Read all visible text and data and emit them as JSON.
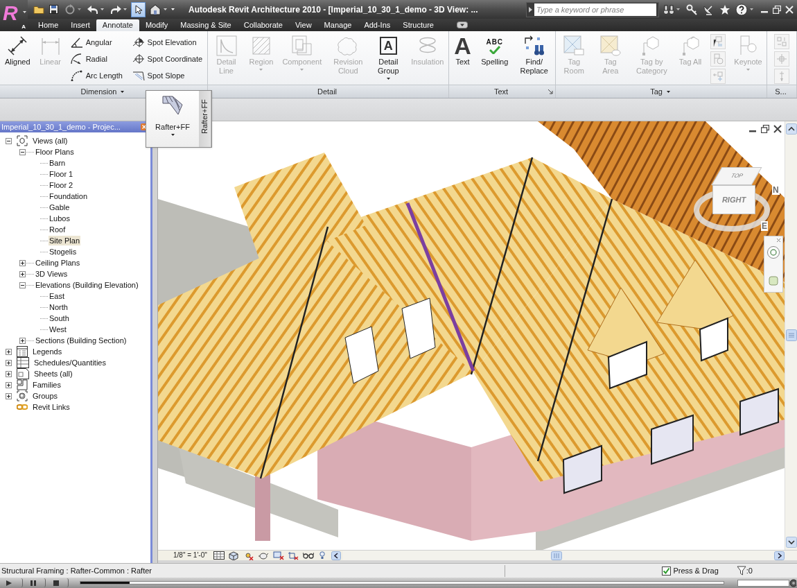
{
  "title_bar": {
    "logo_letter": "R",
    "logo_badge": "A",
    "title": "Autodesk Revit Architecture 2010 - [Imperial_10_30_1_demo - 3D View: ...",
    "search": {
      "placeholder": "Type a keyword or phrase"
    }
  },
  "ribbon_tabs": [
    {
      "label": "Home",
      "selected": false
    },
    {
      "label": "Insert",
      "selected": false
    },
    {
      "label": "Annotate",
      "selected": true
    },
    {
      "label": "Modify",
      "selected": false
    },
    {
      "label": "Massing & Site",
      "selected": false
    },
    {
      "label": "Collaborate",
      "selected": false
    },
    {
      "label": "View",
      "selected": false
    },
    {
      "label": "Manage",
      "selected": false
    },
    {
      "label": "Add-Ins",
      "selected": false
    },
    {
      "label": "Structure",
      "selected": false
    }
  ],
  "ribbon_panels": [
    {
      "title": "Dimension",
      "menu": true,
      "launcher": false,
      "columns": [
        {
          "kind": "large",
          "buttons": [
            {
              "label": "Aligned",
              "disabled": false,
              "menu": false
            }
          ]
        },
        {
          "kind": "large",
          "buttons": [
            {
              "label": "Linear",
              "disabled": true,
              "menu": false
            }
          ]
        },
        {
          "kind": "stack",
          "buttons": [
            {
              "label": "Angular",
              "disabled": false
            },
            {
              "label": "Radial",
              "disabled": false
            },
            {
              "label": "Arc Length",
              "disabled": false
            }
          ]
        },
        {
          "kind": "stack",
          "buttons": [
            {
              "label": "Spot Elevation",
              "disabled": false
            },
            {
              "label": "Spot Coordinate",
              "disabled": false
            },
            {
              "label": "Spot Slope",
              "disabled": false
            }
          ]
        }
      ]
    },
    {
      "title": "Detail",
      "menu": false,
      "launcher": false,
      "columns": [
        {
          "kind": "large",
          "buttons": [
            {
              "label": "Detail Line",
              "disabled": true,
              "menu": false
            }
          ]
        },
        {
          "kind": "large",
          "buttons": [
            {
              "label": "Region",
              "disabled": true,
              "menu": true
            }
          ]
        },
        {
          "kind": "large",
          "buttons": [
            {
              "label": "Component",
              "disabled": true,
              "menu": true
            }
          ]
        },
        {
          "kind": "large",
          "buttons": [
            {
              "label": "Revision Cloud",
              "disabled": true,
              "menu": false
            }
          ]
        },
        {
          "kind": "large",
          "buttons": [
            {
              "label": "Detail Group",
              "disabled": false,
              "menu": true,
              "glyph": "A"
            }
          ]
        },
        {
          "kind": "large",
          "buttons": [
            {
              "label": "Insulation",
              "disabled": true,
              "menu": false
            }
          ]
        }
      ]
    },
    {
      "title": "Text",
      "menu": false,
      "launcher": true,
      "columns": [
        {
          "kind": "large",
          "buttons": [
            {
              "label": "Text",
              "disabled": false,
              "menu": false,
              "glyph": "A"
            }
          ]
        },
        {
          "kind": "large",
          "buttons": [
            {
              "label": "Spelling",
              "disabled": false,
              "menu": false,
              "glyph": "ABC"
            }
          ]
        },
        {
          "kind": "large",
          "buttons": [
            {
              "label": "Find/Replace",
              "disabled": false,
              "menu": false
            }
          ]
        }
      ]
    },
    {
      "title": "Tag",
      "menu": true,
      "launcher": false,
      "columns": [
        {
          "kind": "large",
          "buttons": [
            {
              "label": "Tag Room",
              "disabled": true,
              "menu": false
            }
          ]
        },
        {
          "kind": "large",
          "buttons": [
            {
              "label": "Tag Area",
              "disabled": true,
              "menu": false
            }
          ]
        },
        {
          "kind": "large",
          "buttons": [
            {
              "label": "Tag by Category",
              "disabled": true,
              "menu": false
            }
          ]
        },
        {
          "kind": "large",
          "buttons": [
            {
              "label": "Tag All",
              "disabled": true,
              "menu": false
            }
          ]
        },
        {
          "kind": "icons",
          "buttons": [
            {
              "disabled": true
            },
            {
              "disabled": true
            },
            {
              "disabled": true
            }
          ]
        },
        {
          "kind": "large",
          "buttons": [
            {
              "label": "Keynote",
              "disabled": true,
              "menu": true
            }
          ]
        }
      ]
    },
    {
      "title": "S...",
      "menu": false,
      "launcher": false,
      "columns": [
        {
          "kind": "icons",
          "buttons": [
            {
              "disabled": true
            },
            {
              "disabled": true
            },
            {
              "disabled": true
            }
          ]
        }
      ]
    }
  ],
  "flyout": {
    "label": "Rafter+FF",
    "menu": true,
    "tab_label": "Rafter+FF"
  },
  "project_browser": {
    "title": "Imperial_10_30_1_demo - Projec...",
    "tree": [
      {
        "label": "Views (all)",
        "kind": "views",
        "expanded": true,
        "selected": false,
        "children": [
          {
            "label": "Floor Plans",
            "expanded": true,
            "selected": false,
            "children": [
              {
                "label": "Barn",
                "selected": false
              },
              {
                "label": "Floor 1",
                "selected": false
              },
              {
                "label": "Floor 2",
                "selected": false
              },
              {
                "label": "Foundation",
                "selected": false
              },
              {
                "label": "Gable",
                "selected": false
              },
              {
                "label": "Lubos",
                "selected": false
              },
              {
                "label": "Roof",
                "selected": false
              },
              {
                "label": "Site Plan",
                "selected": true
              },
              {
                "label": "Stogelis",
                "selected": false
              }
            ]
          },
          {
            "label": "Ceiling Plans",
            "expanded": false,
            "selected": false
          },
          {
            "label": "3D Views",
            "expanded": false,
            "selected": false
          },
          {
            "label": "Elevations (Building Elevation)",
            "expanded": true,
            "selected": false,
            "children": [
              {
                "label": "East",
                "selected": false
              },
              {
                "label": "North",
                "selected": false
              },
              {
                "label": "South",
                "selected": false
              },
              {
                "label": "West",
                "selected": false
              }
            ]
          },
          {
            "label": "Sections (Building Section)",
            "expanded": false,
            "selected": false
          }
        ]
      },
      {
        "label": "Legends",
        "kind": "legends",
        "expanded": false,
        "selected": false
      },
      {
        "label": "Schedules/Quantities",
        "kind": "schedules",
        "expanded": false,
        "selected": false
      },
      {
        "label": "Sheets (all)",
        "kind": "sheets",
        "expanded": false,
        "selected": false
      },
      {
        "label": "Families",
        "kind": "families",
        "expanded": false,
        "selected": false
      },
      {
        "label": "Groups",
        "kind": "groups",
        "expanded": false,
        "selected": false
      },
      {
        "label": "Revit Links",
        "kind": "links",
        "selected": false
      }
    ]
  },
  "view": {
    "viewcube": {
      "top": "TOP",
      "front": "RIGHT",
      "compass": [
        "N",
        "E"
      ]
    },
    "scale": "1/8\" = 1'-0\""
  },
  "status_bar": {
    "text": "Structural Framing : Rafter-Common : Rafter",
    "press_drag": {
      "label": "Press & Drag",
      "checked": true
    },
    "filter_count": ":0"
  },
  "player": {
    "progress": {
      "level": 0.077
    }
  }
}
